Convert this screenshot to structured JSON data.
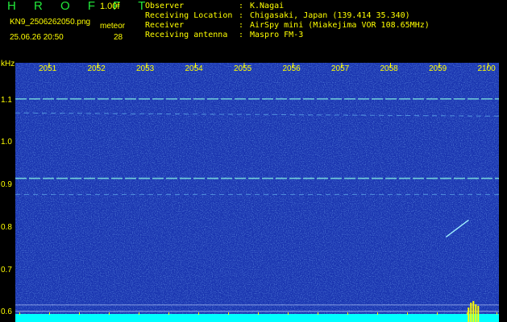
{
  "header": {
    "app_title": "H R O F F T",
    "version": "1.00f",
    "filename": "KN9_2506262050.png",
    "mode": "meteor",
    "datetime": "25.06.26 20:50",
    "count": "28"
  },
  "info": [
    {
      "label": "Observer",
      "sep": ":",
      "value": "K.Nagai"
    },
    {
      "label": "Receiving Location",
      "sep": ":",
      "value": "Chigasaki, Japan (139.414 35.340)"
    },
    {
      "label": "Receiver",
      "sep": ":",
      "value": "AirSpy mini (Miakejima VOR 108.65MHz)"
    },
    {
      "label": "Receiving antenna",
      "sep": ":",
      "value": "Maspro FM-3"
    }
  ],
  "colors": {
    "background": "#000000",
    "label": "#ffff00",
    "title": "#22e83a",
    "spectrogram": "#1a35b0",
    "noise_floor": "#00ffff",
    "meteor_bar": "#ffff00"
  },
  "chart_data": {
    "type": "heatmap",
    "y_unit_label": "kHz",
    "x_ticks": [
      "2051",
      "2052",
      "2053",
      "2054",
      "2055",
      "2056",
      "2057",
      "2058",
      "2059",
      "2100"
    ],
    "y_ticks": [
      "1.1",
      "1.0",
      "0.9",
      "0.8",
      "0.7",
      "0.6"
    ],
    "ylim": [
      0.58,
      1.19
    ],
    "carrier_lines_khz": [
      1.105,
      0.918,
      1.072,
      0.88
    ],
    "meteor_echo": {
      "time_from": "2059.6",
      "time_to": "2059.9",
      "khz_from": 0.78,
      "khz_to": 0.82
    },
    "grid": false
  }
}
